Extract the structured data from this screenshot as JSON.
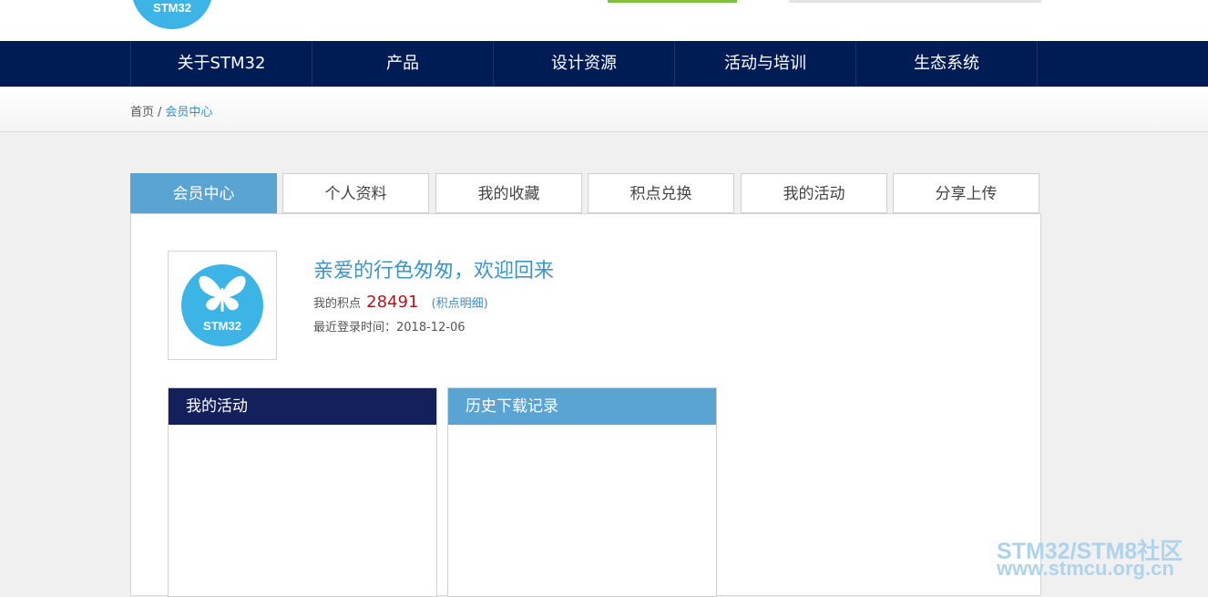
{
  "header": {
    "logo_text": "STM32"
  },
  "nav": {
    "items": [
      {
        "label": "关于STM32"
      },
      {
        "label": "产品"
      },
      {
        "label": "设计资源"
      },
      {
        "label": "活动与培训"
      },
      {
        "label": "生态系统"
      }
    ]
  },
  "breadcrumb": {
    "home": "首页",
    "separator": "/",
    "current": "会员中心"
  },
  "tabs": [
    {
      "label": "会员中心",
      "active": true
    },
    {
      "label": "个人资料",
      "active": false
    },
    {
      "label": "我的收藏",
      "active": false
    },
    {
      "label": "积点兑换",
      "active": false
    },
    {
      "label": "我的活动",
      "active": false
    },
    {
      "label": "分享上传",
      "active": false
    }
  ],
  "profile": {
    "avatar_text": "STM32",
    "welcome": "亲爱的行色匆匆，欢迎回来",
    "points_label": "我的积点",
    "points_value": "28491",
    "points_link": "(积点明细)",
    "last_login": "最近登录时间：2018-12-06"
  },
  "panels": {
    "activities_title": "我的活动",
    "downloads_title": "历史下载记录"
  },
  "watermark": {
    "line1": "STM32/STM8社区",
    "line2": "www.stmcu.org.cn"
  },
  "colors": {
    "nav_bg": "#001c54",
    "accent": "#5aa4d4",
    "dark_header": "#14205c",
    "points": "#b0161d",
    "logo": "#3cb4e5"
  }
}
